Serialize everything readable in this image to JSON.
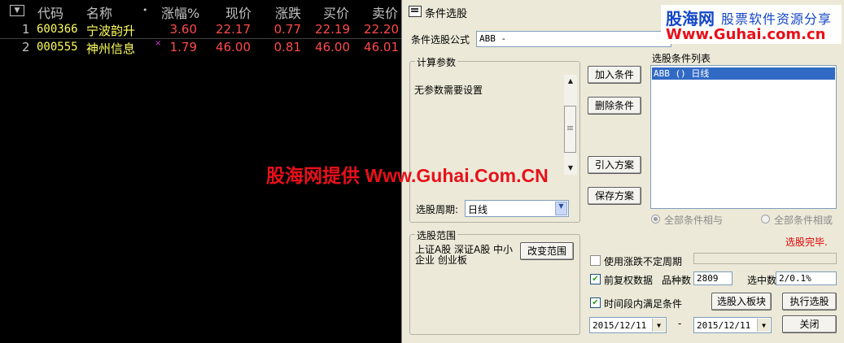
{
  "table": {
    "sort_icon": "▼",
    "headers": {
      "code": "代码",
      "name": "名称",
      "dot": "•",
      "change_pct": "涨幅%",
      "price": "现价",
      "change": "涨跌",
      "bid": "买价",
      "ask": "卖价"
    },
    "rows": [
      {
        "idx": "1",
        "code": "600366",
        "name": "宁波韵升",
        "mark": "",
        "change_pct": "3.60",
        "price": "22.17",
        "change": "0.77",
        "bid": "22.19",
        "ask": "22.20"
      },
      {
        "idx": "2",
        "code": "000555",
        "name": "神州信息",
        "mark": "×",
        "change_pct": "1.79",
        "price": "46.00",
        "change": "0.81",
        "bid": "46.00",
        "ask": "46.01"
      }
    ]
  },
  "dialog": {
    "title": "条件选股",
    "formula_label": "条件选股公式",
    "formula_value": "ABB        -",
    "params_group": "计算参数",
    "params_text": "无参数需要设置",
    "period_label": "选股周期:",
    "period_value": "日线",
    "buttons": {
      "add": "加入条件",
      "delete": "删除条件",
      "import": "引入方案",
      "save": "保存方案",
      "change_range": "改变范围",
      "to_block": "选股入板块",
      "execute": "执行选股",
      "close": "关闭"
    },
    "condition_list_label": "选股条件列表",
    "condition_items": [
      "ABB  () 日线"
    ],
    "radio_and": "全部条件相与",
    "radio_or": "全部条件相或",
    "status": "选股完毕.",
    "range_group": "选股范围",
    "range_text": "上证A股 深证A股 中小企业 创业板",
    "use_uncertain_period": "使用涨跌不定周期",
    "forward_adjust": "前复权数据",
    "variety_count_label": "品种数",
    "variety_count": "2809",
    "selected_count_label": "选中数",
    "selected_count": "2/0.1%",
    "time_range_check": "时间段内满足条件",
    "date_from": "2015/12/11",
    "date_sep": "-",
    "date_to": "2015/12/11"
  },
  "watermark": {
    "center": "股海网提供 Www.Guhai.Com.CN",
    "logo_line1a": "股海网",
    "logo_line1b": "股票软件资源分享",
    "logo_line2": "Www.Guhai.com.cn"
  },
  "colors": {
    "bg": "#000000",
    "stock_name": "#ffff60",
    "up": "#ff4a4a",
    "dialog_bg": "#ece9d8",
    "selection": "#316ac5",
    "watermark_red": "#e8101a",
    "watermark_blue": "#1346c8"
  }
}
